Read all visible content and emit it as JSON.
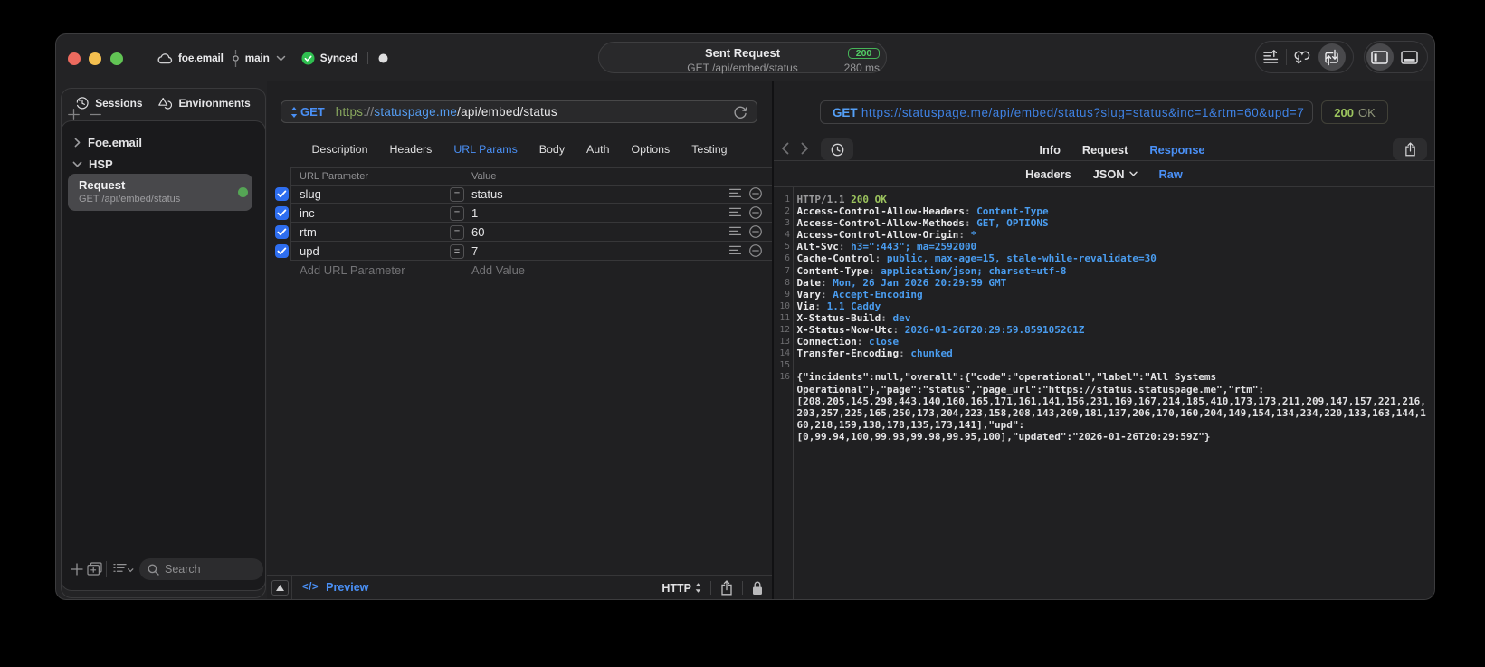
{
  "titlebar": {
    "project_name": "foe.email",
    "branch": "main",
    "sync_status": "Synced",
    "sent_request": {
      "title": "Sent Request",
      "subtitle": "GET /api/embed/status",
      "status_code": "200",
      "duration": "280 ms"
    }
  },
  "sidebar": {
    "tabs": [
      {
        "label": "Sessions",
        "icon": "history-clock-icon"
      },
      {
        "label": "Environments",
        "icon": "environments-icon"
      }
    ],
    "tree": [
      {
        "label": "Foe.email",
        "expanded": false
      },
      {
        "label": "HSP",
        "expanded": true
      }
    ],
    "request_item": {
      "title": "Request",
      "subtitle": "GET /api/embed/status",
      "status_dot_color": "#55a555"
    },
    "search_placeholder": "Search"
  },
  "request_panel": {
    "method": "GET",
    "url_parts": {
      "scheme": "https",
      "separator": "://",
      "host": "statuspage.me",
      "path": "/api/embed/status"
    },
    "tabs": [
      "Description",
      "Headers",
      "URL Params",
      "Body",
      "Auth",
      "Options",
      "Testing"
    ],
    "active_tab": "URL Params",
    "table": {
      "columns": [
        "URL Parameter",
        "Value"
      ],
      "rows": [
        {
          "checked": true,
          "name": "slug",
          "operator": "=",
          "value": "status"
        },
        {
          "checked": true,
          "name": "inc",
          "operator": "=",
          "value": "1"
        },
        {
          "checked": true,
          "name": "rtm",
          "operator": "=",
          "value": "60"
        },
        {
          "checked": true,
          "name": "upd",
          "operator": "=",
          "value": "7"
        }
      ],
      "add_row": {
        "name_placeholder": "Add URL Parameter",
        "value_placeholder": "Add Value"
      }
    },
    "bottom_bar": {
      "preview_label": "Preview",
      "protocol": "HTTP"
    }
  },
  "response_panel": {
    "request_line": {
      "method": "GET",
      "url": "https://statuspage.me/api/embed/status?slug=status&inc=1&rtm=60&upd=7"
    },
    "status": {
      "code": "200",
      "text": "OK"
    },
    "tabs": [
      "Info",
      "Request",
      "Response"
    ],
    "active_tab": "Response",
    "subtabs": [
      "Headers",
      "JSON",
      "Raw"
    ],
    "active_subtab": "Raw",
    "raw_lines": [
      {
        "n": "1",
        "parts": [
          [
            "HTTP/1.1 ",
            "dim"
          ],
          [
            "200 OK",
            "green"
          ]
        ]
      },
      {
        "n": "2",
        "parts": [
          [
            "Access-Control-Allow-Headers",
            "name"
          ],
          [
            ": ",
            "dim"
          ],
          [
            "Content-Type",
            "val"
          ]
        ]
      },
      {
        "n": "3",
        "parts": [
          [
            "Access-Control-Allow-Methods",
            "name"
          ],
          [
            ": ",
            "dim"
          ],
          [
            "GET, OPTIONS",
            "val"
          ]
        ]
      },
      {
        "n": "4",
        "parts": [
          [
            "Access-Control-Allow-Origin",
            "name"
          ],
          [
            ": ",
            "dim"
          ],
          [
            "*",
            "val"
          ]
        ]
      },
      {
        "n": "5",
        "parts": [
          [
            "Alt-Svc",
            "name"
          ],
          [
            ": ",
            "dim"
          ],
          [
            "h3=\":443\"; ma=2592000",
            "val"
          ]
        ]
      },
      {
        "n": "6",
        "parts": [
          [
            "Cache-Control",
            "name"
          ],
          [
            ": ",
            "dim"
          ],
          [
            "public, max-age=15, stale-while-revalidate=30",
            "val"
          ]
        ]
      },
      {
        "n": "7",
        "parts": [
          [
            "Content-Type",
            "name"
          ],
          [
            ": ",
            "dim"
          ],
          [
            "application/json; charset=utf-8",
            "val"
          ]
        ]
      },
      {
        "n": "8",
        "parts": [
          [
            "Date",
            "name"
          ],
          [
            ": ",
            "dim"
          ],
          [
            "Mon, 26 Jan 2026 20:29:59 GMT",
            "val"
          ]
        ]
      },
      {
        "n": "9",
        "parts": [
          [
            "Vary",
            "name"
          ],
          [
            ": ",
            "dim"
          ],
          [
            "Accept-Encoding",
            "val"
          ]
        ]
      },
      {
        "n": "10",
        "parts": [
          [
            "Via",
            "name"
          ],
          [
            ": ",
            "dim"
          ],
          [
            "1.1 Caddy",
            "val"
          ]
        ]
      },
      {
        "n": "11",
        "parts": [
          [
            "X-Status-Build",
            "name"
          ],
          [
            ": ",
            "dim"
          ],
          [
            "dev",
            "val"
          ]
        ]
      },
      {
        "n": "12",
        "parts": [
          [
            "X-Status-Now-Utc",
            "name"
          ],
          [
            ": ",
            "dim"
          ],
          [
            "2026-01-26T20:29:59.859105261Z",
            "val"
          ]
        ]
      },
      {
        "n": "13",
        "parts": [
          [
            "Connection",
            "name"
          ],
          [
            ": ",
            "dim"
          ],
          [
            "close",
            "val"
          ]
        ]
      },
      {
        "n": "14",
        "parts": [
          [
            "Transfer-Encoding",
            "name"
          ],
          [
            ": ",
            "dim"
          ],
          [
            "chunked",
            "val"
          ]
        ]
      },
      {
        "n": "15",
        "parts": []
      },
      {
        "n": "16",
        "parts": [
          [
            "{\"incidents\":null,\"overall\":{\"code\":\"operational\",\"label\":\"All Systems",
            "body"
          ]
        ]
      },
      {
        "n": "",
        "parts": [
          [
            "Operational\"},\"page\":\"status\",\"page_url\":\"https://status.statuspage.me\",\"rtm\":",
            "body"
          ]
        ]
      },
      {
        "n": "",
        "parts": [
          [
            "[208,205,145,298,443,140,160,165,171,161,141,156,231,169,167,214,185,410,173,173,211,209,147,157,221,216,",
            "body"
          ]
        ]
      },
      {
        "n": "",
        "parts": [
          [
            "203,257,225,165,250,173,204,223,158,208,143,209,181,137,206,170,160,204,149,154,134,234,220,133,163,144,1",
            "body"
          ]
        ]
      },
      {
        "n": "",
        "parts": [
          [
            "60,218,159,138,178,135,173,141],\"upd\":",
            "body"
          ]
        ]
      },
      {
        "n": "",
        "parts": [
          [
            "[0,99.94,100,99.93,99.98,99.95,100],\"updated\":\"2026-01-26T20:29:59Z\"}",
            "body"
          ]
        ]
      }
    ]
  },
  "colors": {
    "accent_blue": "#4a90f6",
    "value_blue": "#4a9df0",
    "status_green": "#9cc45e",
    "sync_green": "#2fbf50",
    "checkbox_blue": "#2e6ef0"
  }
}
